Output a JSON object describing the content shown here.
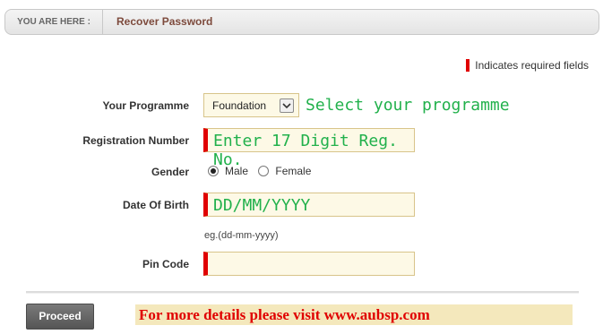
{
  "breadcrumb": {
    "label": "YOU ARE HERE :",
    "current": "Recover Password"
  },
  "required_note": "Indicates required fields",
  "form": {
    "programme_label": "Your Programme",
    "programme_value": "Foundation",
    "programme_hint": "Select your programme",
    "registration_label": "Registration Number",
    "registration_hint": "Enter 17 Digit Reg. No.",
    "gender_label": "Gender",
    "gender_options": [
      "Male",
      "Female"
    ],
    "gender_selected": "Male",
    "dob_label": "Date Of Birth",
    "dob_hint": "DD/MM/YYYY",
    "dob_example": "eg.(dd-mm-yyyy)",
    "pin_label": "Pin Code",
    "pin_value": ""
  },
  "proceed_label": "Proceed",
  "banner_text": "For more details please visit www.aubsp.com",
  "colors": {
    "required_marker": "#e00000",
    "hint_text": "#22b14c",
    "banner_bg": "#f4e8bc",
    "banner_text": "#e00000",
    "field_bg": "#fdf9e6"
  }
}
